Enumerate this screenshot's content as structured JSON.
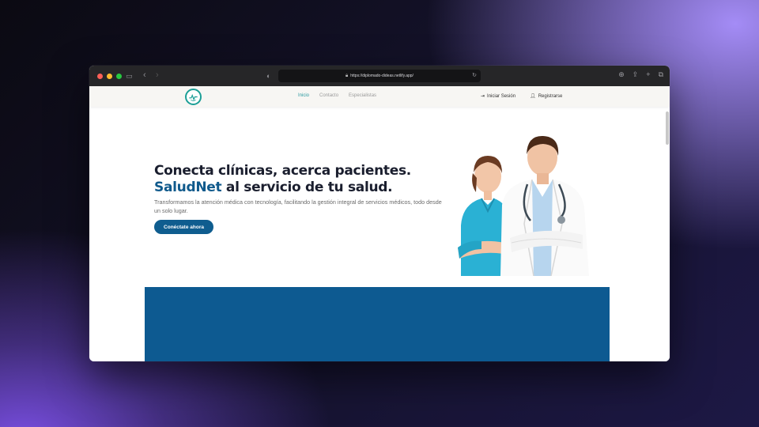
{
  "browser": {
    "url": "https://diplomado-dideas.netlify.app/",
    "icons": [
      "sidebar-icon",
      "back-icon",
      "forward-icon",
      "shield-icon",
      "lock-icon",
      "reload-icon",
      "download-icon",
      "share-icon",
      "new-tab-icon",
      "tabs-icon"
    ]
  },
  "nav": {
    "links": [
      {
        "label": "Inicio",
        "active": true
      },
      {
        "label": "Contacto",
        "active": false
      },
      {
        "label": "Especialistas",
        "active": false
      }
    ],
    "login_label": "Iniciar Sesión",
    "register_label": "Registrarse"
  },
  "hero": {
    "title_line1": "Conecta clínicas, acerca pacientes.",
    "title_brand": "SaludNet",
    "title_line2_rest": " al servicio de tu salud.",
    "description": "Transformamos la atención médica con tecnología, facilitando la gestión integral de servicios médicos, todo desde un solo lugar.",
    "cta_label": "Conéctate ahora"
  },
  "colors": {
    "brand": "#105a8c",
    "accent_teal": "#2a9aa0",
    "button": "#0f5d8f",
    "section_blue": "#0d5a91"
  }
}
